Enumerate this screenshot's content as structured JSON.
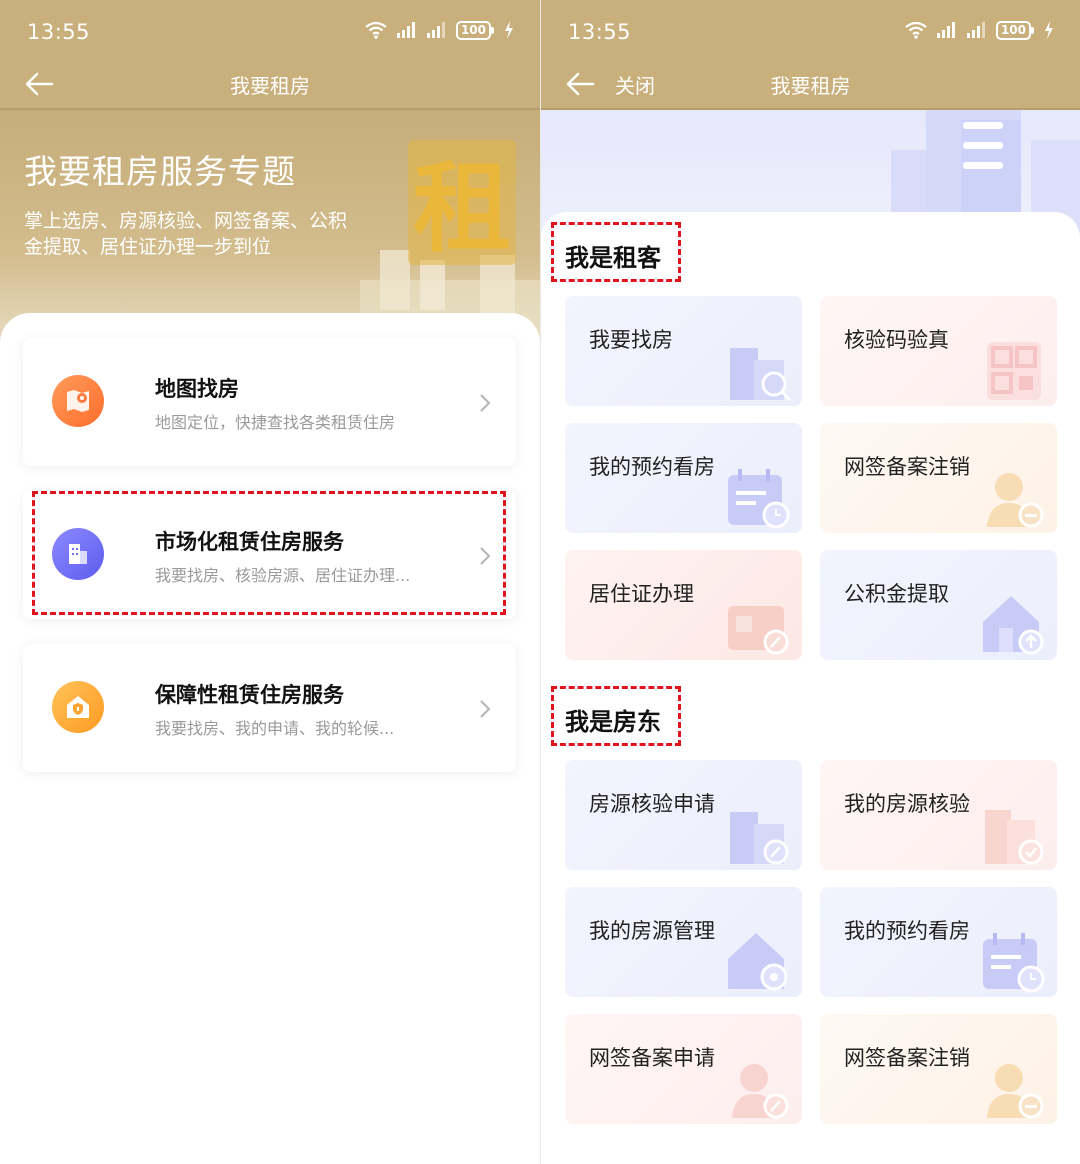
{
  "left": {
    "status": {
      "time": "13:55",
      "battery": "100"
    },
    "nav": {
      "title": "我要租房"
    },
    "hero": {
      "title": "我要租房服务专题",
      "subtitle": "掌上选房、房源核验、网签备案、公积金提取、居住证办理一步到位",
      "deco_char": "租"
    },
    "cards": [
      {
        "name": "地图找房",
        "desc": "地图定位，快捷查找各类租赁住房",
        "color": "#ff7a3d"
      },
      {
        "name": "市场化租赁住房服务",
        "desc": "我要找房、核验房源、居住证办理...",
        "color": "#6d6cf3"
      },
      {
        "name": "保障性租赁住房服务",
        "desc": "我要找房、我的申请、我的轮候...",
        "color": "#ffa433"
      }
    ]
  },
  "right": {
    "status": {
      "time": "13:55",
      "battery": "100"
    },
    "nav": {
      "close": "关闭",
      "title": "我要租房"
    },
    "tenant": {
      "title": "我是租客",
      "tiles": [
        "我要找房",
        "核验码验真",
        "我的预约看房",
        "网签备案注销",
        "居住证办理",
        "公积金提取"
      ]
    },
    "landlord": {
      "title": "我是房东",
      "tiles": [
        "房源核验申请",
        "我的房源核验",
        "我的房源管理",
        "我的预约看房",
        "网签备案申请",
        "网签备案注销"
      ]
    }
  },
  "colors": {
    "gold": "#c8af7c",
    "highlight": "#e0141c"
  }
}
